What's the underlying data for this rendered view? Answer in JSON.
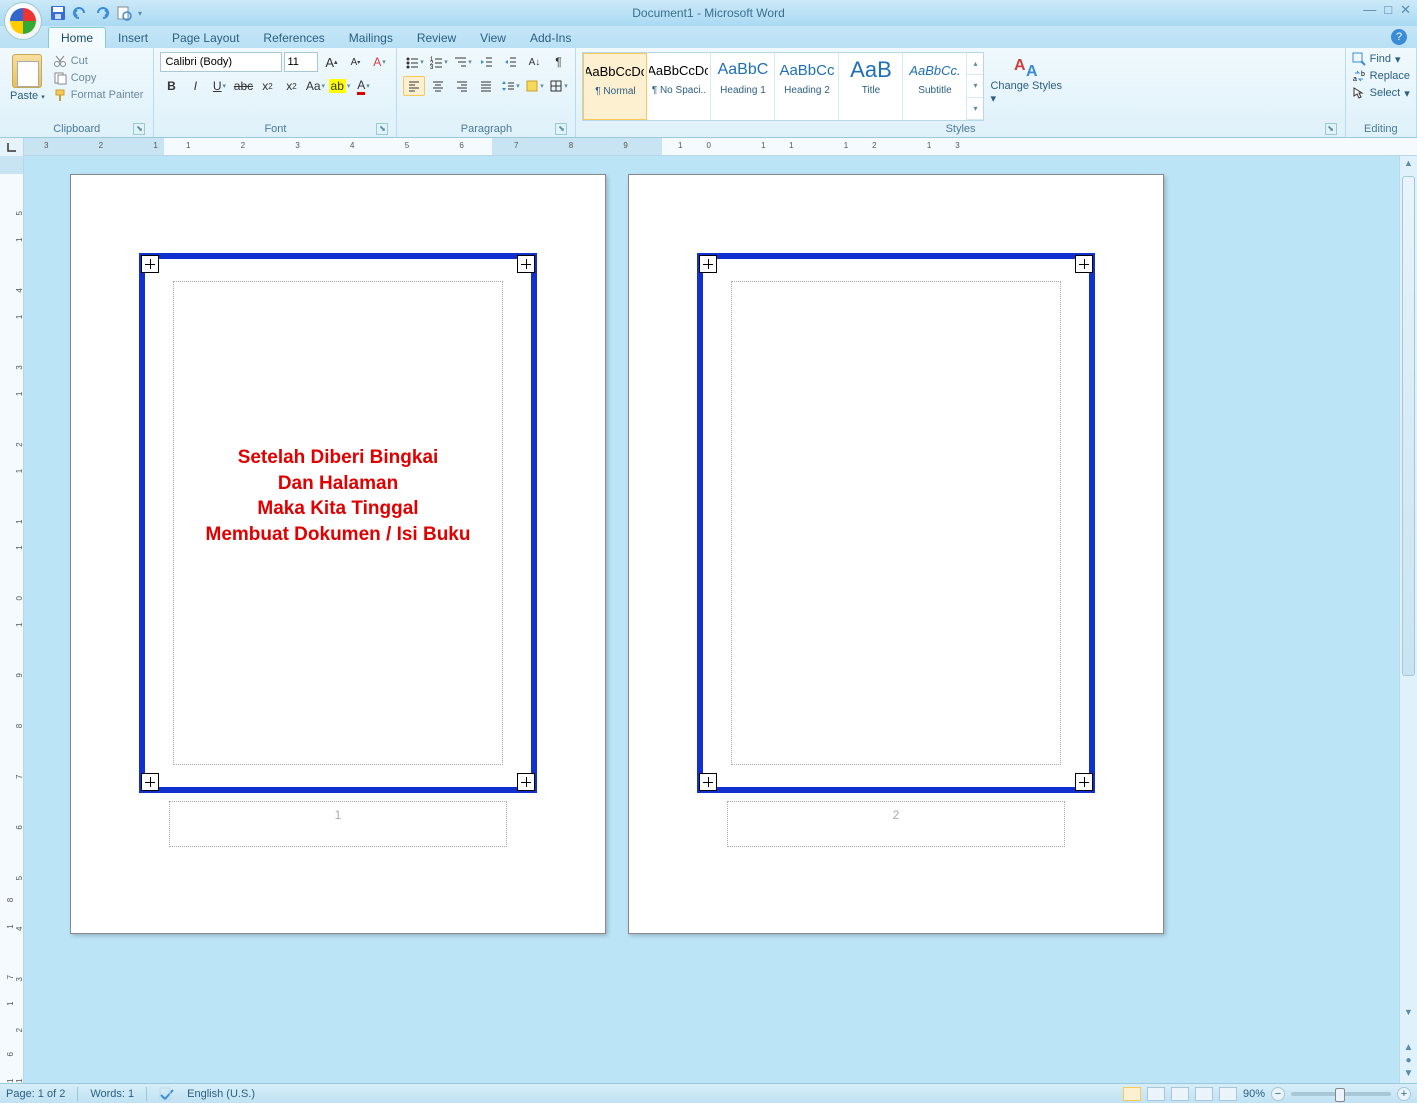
{
  "title": {
    "doc": "Document1",
    "app": "Microsoft Word"
  },
  "tabs": [
    "Home",
    "Insert",
    "Page Layout",
    "References",
    "Mailings",
    "Review",
    "View",
    "Add-Ins"
  ],
  "active_tab": "Home",
  "clipboard": {
    "paste": "Paste",
    "cut": "Cut",
    "copy": "Copy",
    "format": "Format Painter",
    "label": "Clipboard"
  },
  "font": {
    "name": "Calibri (Body)",
    "size": "11",
    "label": "Font"
  },
  "paragraph": {
    "label": "Paragraph"
  },
  "styles": {
    "label": "Styles",
    "items": [
      {
        "preview": "AaBbCcDc",
        "name": "¶ Normal",
        "color": "#000",
        "selected": true
      },
      {
        "preview": "AaBbCcDc",
        "name": "¶ No Spaci..",
        "color": "#000"
      },
      {
        "preview": "AaBbC",
        "name": "Heading 1",
        "color": "#1f6fb8",
        "size": "16px"
      },
      {
        "preview": "AaBbCc",
        "name": "Heading 2",
        "color": "#1f6fb8",
        "size": "15px"
      },
      {
        "preview": "AaB",
        "name": "Title",
        "color": "#1f6fb8",
        "size": "22px"
      },
      {
        "preview": "AaBbCc.",
        "name": "Subtitle",
        "color": "#1f6fb8",
        "style": "italic"
      }
    ],
    "change": "Change Styles"
  },
  "editing": {
    "find": "Find",
    "replace": "Replace",
    "select": "Select",
    "label": "Editing"
  },
  "document": {
    "page1_text": "Setelah Diberi Bingkai\nDan Halaman\nMaka Kita Tinggal\nMembuat Dokumen / Isi Buku",
    "page1_num": "1",
    "page2_num": "2"
  },
  "status": {
    "page": "Page: 1 of 2",
    "words": "Words: 1",
    "lang": "English (U.S.)",
    "zoom": "90%"
  }
}
